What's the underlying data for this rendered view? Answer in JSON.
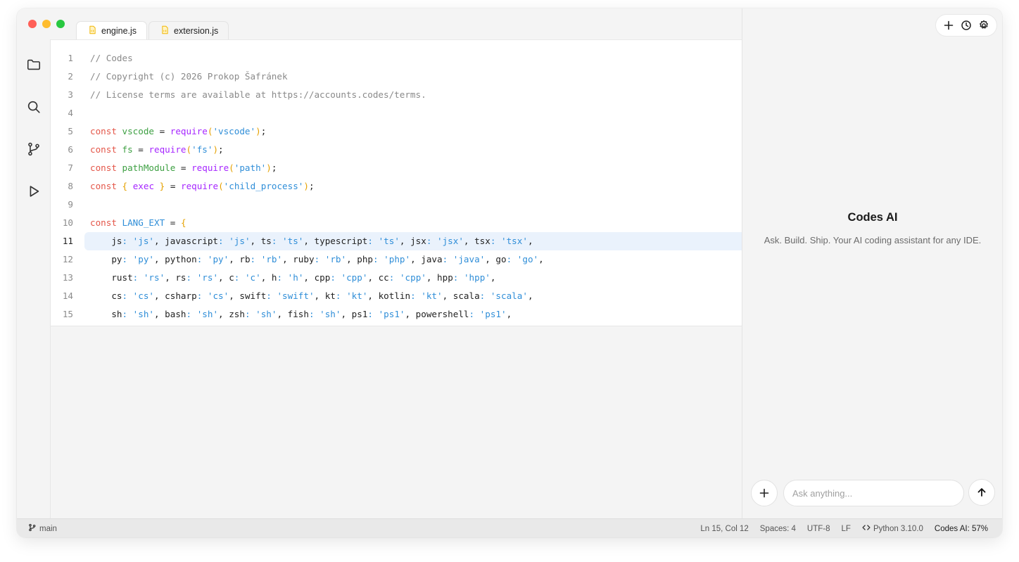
{
  "tabs": [
    {
      "label": "engine.js",
      "active": true
    },
    {
      "label": "extersion.js",
      "active": false
    }
  ],
  "editor": {
    "current_line": 11,
    "lines": [
      {
        "n": "1",
        "tokens": [
          [
            "// Codes",
            "com"
          ]
        ]
      },
      {
        "n": "2",
        "tokens": [
          [
            "// Copyright (c) 2026 Prokop Šafránek",
            "com"
          ]
        ]
      },
      {
        "n": "3",
        "tokens": [
          [
            "// License terms are available at https://accounts.codes/terms.",
            "com"
          ]
        ]
      },
      {
        "n": "4",
        "tokens": []
      },
      {
        "n": "5",
        "tokens": [
          [
            "const",
            "kw"
          ],
          [
            " ",
            "id"
          ],
          [
            "vscode",
            "var"
          ],
          [
            " = ",
            "id"
          ],
          [
            "require",
            "fn"
          ],
          [
            "(",
            "paren"
          ],
          [
            "'vscode'",
            "str"
          ],
          [
            ")",
            "paren"
          ],
          [
            ";",
            "id"
          ]
        ]
      },
      {
        "n": "6",
        "tokens": [
          [
            "const",
            "kw"
          ],
          [
            " ",
            "id"
          ],
          [
            "fs",
            "var"
          ],
          [
            " = ",
            "id"
          ],
          [
            "require",
            "fn"
          ],
          [
            "(",
            "paren"
          ],
          [
            "'fs'",
            "str"
          ],
          [
            ")",
            "paren"
          ],
          [
            ";",
            "id"
          ]
        ]
      },
      {
        "n": "7",
        "tokens": [
          [
            "const",
            "kw"
          ],
          [
            " ",
            "id"
          ],
          [
            "pathModule",
            "var"
          ],
          [
            " = ",
            "id"
          ],
          [
            "require",
            "fn"
          ],
          [
            "(",
            "paren"
          ],
          [
            "'path'",
            "str"
          ],
          [
            ")",
            "paren"
          ],
          [
            ";",
            "id"
          ]
        ]
      },
      {
        "n": "8",
        "tokens": [
          [
            "const",
            "kw"
          ],
          [
            " ",
            "id"
          ],
          [
            "{",
            "paren"
          ],
          [
            " ",
            "id"
          ],
          [
            "exec",
            "fn"
          ],
          [
            " ",
            "id"
          ],
          [
            "}",
            "paren"
          ],
          [
            " = ",
            "id"
          ],
          [
            "require",
            "fn"
          ],
          [
            "(",
            "paren"
          ],
          [
            "'child_process'",
            "str"
          ],
          [
            ")",
            "paren"
          ],
          [
            ";",
            "id"
          ]
        ]
      },
      {
        "n": "9",
        "tokens": []
      },
      {
        "n": "10",
        "tokens": [
          [
            "const",
            "kw"
          ],
          [
            " ",
            "id"
          ],
          [
            "LANG_EXT",
            "str"
          ],
          [
            " = ",
            "id"
          ],
          [
            "{",
            "paren"
          ]
        ]
      },
      {
        "n": "11",
        "tokens": [
          [
            "    js",
            "id"
          ],
          [
            ":",
            "str"
          ],
          [
            " 'js'",
            "str"
          ],
          [
            ", javascript",
            "id"
          ],
          [
            ":",
            "str"
          ],
          [
            " 'js'",
            "str"
          ],
          [
            ", ts",
            "id"
          ],
          [
            ":",
            "str"
          ],
          [
            " 'ts'",
            "str"
          ],
          [
            ", typescript",
            "id"
          ],
          [
            ":",
            "str"
          ],
          [
            " 'ts'",
            "str"
          ],
          [
            ", jsx",
            "id"
          ],
          [
            ":",
            "str"
          ],
          [
            " 'jsx'",
            "str"
          ],
          [
            ", tsx",
            "id"
          ],
          [
            ":",
            "str"
          ],
          [
            " 'tsx'",
            "str"
          ],
          [
            ",",
            "id"
          ]
        ]
      },
      {
        "n": "12",
        "tokens": [
          [
            "    py",
            "id"
          ],
          [
            ":",
            "str"
          ],
          [
            " 'py'",
            "str"
          ],
          [
            ", python",
            "id"
          ],
          [
            ":",
            "str"
          ],
          [
            " 'py'",
            "str"
          ],
          [
            ", rb",
            "id"
          ],
          [
            ":",
            "str"
          ],
          [
            " 'rb'",
            "str"
          ],
          [
            ", ruby",
            "id"
          ],
          [
            ":",
            "str"
          ],
          [
            " 'rb'",
            "str"
          ],
          [
            ", php",
            "id"
          ],
          [
            ":",
            "str"
          ],
          [
            " 'php'",
            "str"
          ],
          [
            ", java",
            "id"
          ],
          [
            ":",
            "str"
          ],
          [
            " 'java'",
            "str"
          ],
          [
            ", go",
            "id"
          ],
          [
            ":",
            "str"
          ],
          [
            " 'go'",
            "str"
          ],
          [
            ",",
            "id"
          ]
        ]
      },
      {
        "n": "13",
        "tokens": [
          [
            "    rust",
            "id"
          ],
          [
            ":",
            "str"
          ],
          [
            " 'rs'",
            "str"
          ],
          [
            ", rs",
            "id"
          ],
          [
            ":",
            "str"
          ],
          [
            " 'rs'",
            "str"
          ],
          [
            ", c",
            "id"
          ],
          [
            ":",
            "str"
          ],
          [
            " 'c'",
            "str"
          ],
          [
            ", h",
            "id"
          ],
          [
            ":",
            "str"
          ],
          [
            " 'h'",
            "str"
          ],
          [
            ", cpp",
            "id"
          ],
          [
            ":",
            "str"
          ],
          [
            " 'cpp'",
            "str"
          ],
          [
            ", cc",
            "id"
          ],
          [
            ":",
            "str"
          ],
          [
            " 'cpp'",
            "str"
          ],
          [
            ", hpp",
            "id"
          ],
          [
            ":",
            "str"
          ],
          [
            " 'hpp'",
            "str"
          ],
          [
            ",",
            "id"
          ]
        ]
      },
      {
        "n": "14",
        "tokens": [
          [
            "    cs",
            "id"
          ],
          [
            ":",
            "str"
          ],
          [
            " 'cs'",
            "str"
          ],
          [
            ", csharp",
            "id"
          ],
          [
            ":",
            "str"
          ],
          [
            " 'cs'",
            "str"
          ],
          [
            ", swift",
            "id"
          ],
          [
            ":",
            "str"
          ],
          [
            " 'swift'",
            "str"
          ],
          [
            ", kt",
            "id"
          ],
          [
            ":",
            "str"
          ],
          [
            " 'kt'",
            "str"
          ],
          [
            ", kotlin",
            "id"
          ],
          [
            ":",
            "str"
          ],
          [
            " 'kt'",
            "str"
          ],
          [
            ", scala",
            "id"
          ],
          [
            ":",
            "str"
          ],
          [
            " 'scala'",
            "str"
          ],
          [
            ",",
            "id"
          ]
        ]
      },
      {
        "n": "15",
        "tokens": [
          [
            "    sh",
            "id"
          ],
          [
            ":",
            "str"
          ],
          [
            " 'sh'",
            "str"
          ],
          [
            ", bash",
            "id"
          ],
          [
            ":",
            "str"
          ],
          [
            " 'sh'",
            "str"
          ],
          [
            ", zsh",
            "id"
          ],
          [
            ":",
            "str"
          ],
          [
            " 'sh'",
            "str"
          ],
          [
            ", fish",
            "id"
          ],
          [
            ":",
            "str"
          ],
          [
            " 'sh'",
            "str"
          ],
          [
            ", ps1",
            "id"
          ],
          [
            ":",
            "str"
          ],
          [
            " 'ps1'",
            "str"
          ],
          [
            ", powershell",
            "id"
          ],
          [
            ":",
            "str"
          ],
          [
            " 'ps1'",
            "str"
          ],
          [
            ",",
            "id"
          ]
        ]
      }
    ]
  },
  "ai_panel": {
    "title": "Codes AI",
    "description": "Ask. Build. Ship. Your AI coding assistant for any IDE.",
    "input_placeholder": "Ask anything...",
    "input_value": ""
  },
  "statusbar": {
    "branch": "main",
    "position": "Ln 15, Col 12",
    "spaces": "Spaces: 4",
    "encoding": "UTF-8",
    "eol": "LF",
    "language": "Python 3.10.0",
    "ai_status": "Codes AI: 57%"
  },
  "colors": {
    "comment": "#8a8a8a",
    "keyword": "#e45649",
    "variable": "#3ea043",
    "function": "#a626ff",
    "string": "#2f8ed8",
    "bracket": "#e5a100",
    "current_line_bg": "#eaf2fc"
  }
}
